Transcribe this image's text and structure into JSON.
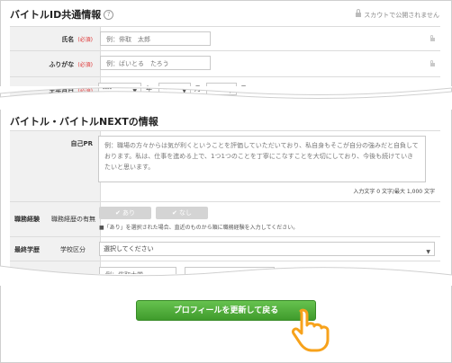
{
  "section1": {
    "title": "バイトルID共通情報",
    "help_icon": "?",
    "scout_note": "スカウトで公開されません",
    "rows": [
      {
        "label": "氏名",
        "required": "(必須)",
        "placeholder": "例：俳取　太郎"
      },
      {
        "label": "ふりがな",
        "required": "(必須)",
        "placeholder": "例：ばいとる　たろう"
      },
      {
        "label": "生年月日",
        "required": "(必須)",
        "year_value": "----",
        "year_unit": "年",
        "month_value": "--",
        "month_unit": "月",
        "day_value": "--",
        "day_unit": "日"
      }
    ]
  },
  "section2": {
    "title": "バイトル・バイトルNEXTの情報",
    "pr": {
      "label": "自己PR",
      "text": "例：職場の方々からは気が利くということを評価していただいており、私自身もそこが自分の強みだと自負しております。私は、仕事を進める上で、1つ1つのことを丁寧にこなすことを大切にしており、今後も続けていきたいと思います。",
      "counter": "入力文字 0 文字/最大 1,000 文字"
    },
    "career": {
      "label": "職務経験",
      "sub_label": "職務経歴の有無",
      "yes": "あり",
      "no": "なし",
      "note": "■「あり」を選択された場合、直近のものから順に職務経験を入力してください。"
    },
    "education": {
      "label": "最終学歴",
      "sub_label": "学校区分",
      "select_value": "選択してください",
      "partial_placeholder": "例：俳取大学"
    }
  },
  "cta": {
    "label": "プロフィールを更新して戻る"
  },
  "icons": {
    "help": "help-icon",
    "lock": "lock-icon",
    "check": "check-icon",
    "hand": "pointing-hand-icon",
    "caret": "chevron-down-icon"
  },
  "colors": {
    "required": "#dd3333",
    "cta_top": "#67c24f",
    "cta_bottom": "#3f9b2c",
    "hand": "#f7a21b",
    "label_bg": "#f1f1f1"
  }
}
